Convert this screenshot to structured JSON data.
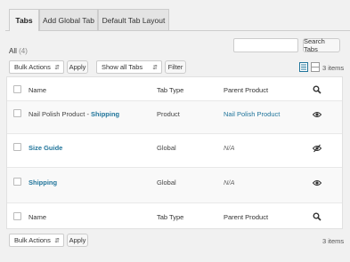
{
  "tabs": [
    "Tabs",
    "Add Global Tab",
    "Default Tab Layout"
  ],
  "filter_summary": {
    "label": "All",
    "count": "(4)"
  },
  "search": {
    "value": "",
    "button": "Search Tabs"
  },
  "bulk_actions": {
    "selected": "Bulk Actions",
    "apply": "Apply"
  },
  "tab_filter": {
    "selected": "Show all Tabs",
    "button": "Filter"
  },
  "item_count": "3 items",
  "table": {
    "columns": [
      "Name",
      "Tab Type",
      "Parent Product"
    ],
    "rows": [
      {
        "name_prefix": "Nail Polish Product - ",
        "name": "Shipping",
        "type": "Product",
        "parent": "Nail Polish Product",
        "visibility_icon": "eye-icon"
      },
      {
        "name_prefix": "",
        "name": "Size Guide",
        "type": "Global",
        "parent": "N/A",
        "visibility_icon": "eye-slash-icon"
      },
      {
        "name_prefix": "",
        "name": "Shipping",
        "type": "Global",
        "parent": "N/A",
        "visibility_icon": "eye-icon"
      }
    ],
    "footer_columns": [
      "Name",
      "Tab Type",
      "Parent Product"
    ]
  },
  "bottom": {
    "bulk_selected": "Bulk Actions",
    "apply": "Apply",
    "count": "3 items"
  }
}
